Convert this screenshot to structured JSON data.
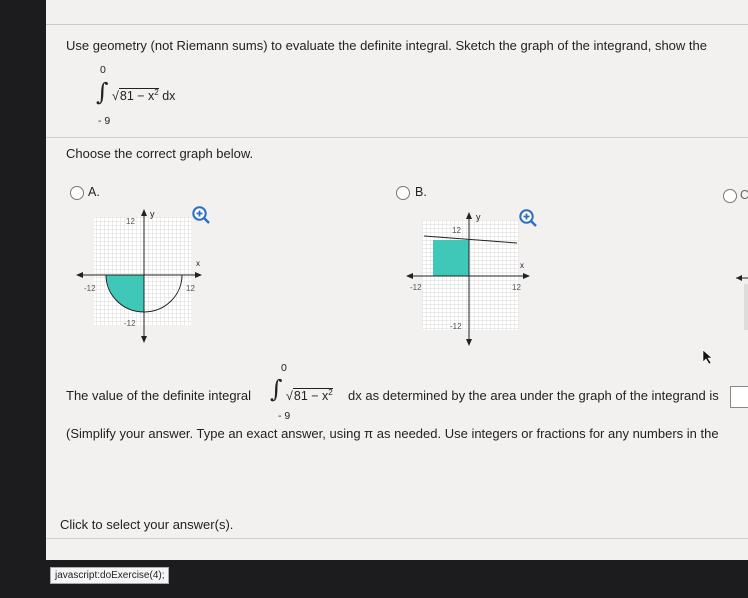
{
  "question": {
    "instruction": "Use geometry (not Riemann sums) to evaluate the definite integral. Sketch the graph of the integrand, show the",
    "integral": {
      "upper": "0",
      "lower": "- 9",
      "integrand": "81 − x",
      "exponent": "2",
      "dx": "dx"
    }
  },
  "graph_prompt": "Choose the correct graph below.",
  "options": [
    {
      "letter": "A.",
      "axis_y": "y",
      "axis_x": "x",
      "top_label": "12",
      "left_label": "-12",
      "right_label": "12",
      "bottom_label": "-12"
    },
    {
      "letter": "B.",
      "axis_y": "y",
      "axis_x": "x",
      "top_label": "12",
      "left_label": "-12",
      "right_label": "12",
      "bottom_label": "-12"
    },
    {
      "letter": "C"
    }
  ],
  "answer": {
    "prefix": "The value of the definite integral",
    "upper": "0",
    "lower": "- 9",
    "integrand": "81 − x",
    "exponent": "2",
    "suffix": "dx as determined by the area under the graph of the integrand is",
    "hint": "(Simplify your answer. Type an exact answer, using π as needed. Use integers or fractions for any numbers in the"
  },
  "click_prompt": "Click to select your answer(s).",
  "status_bar": "javascript:doExercise(4);",
  "colors": {
    "fill": "#3fc8b8",
    "accent": "#2a6fc0"
  },
  "icons": [
    "zoom-in-icon",
    "radio-icon",
    "cursor-icon"
  ]
}
